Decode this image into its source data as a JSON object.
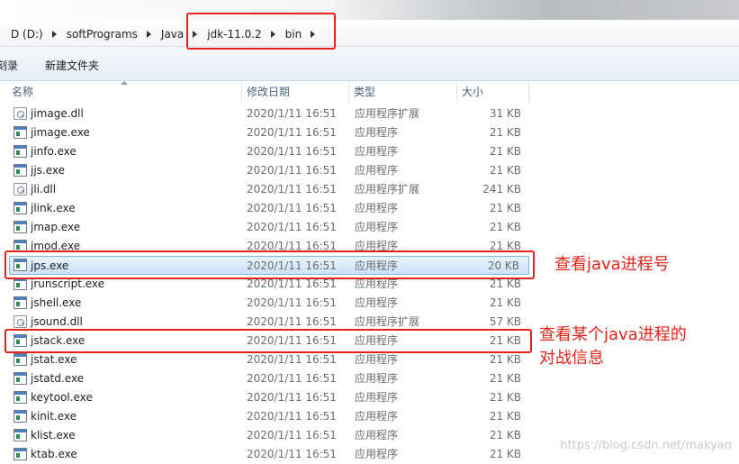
{
  "breadcrumb": [
    "D (D:)",
    "softPrograms",
    "Java",
    "jdk-11.0.2",
    "bin"
  ],
  "toolbar": {
    "item_left": "刻录",
    "new_folder": "新建文件夹"
  },
  "columns": {
    "name": "名称",
    "date": "修改日期",
    "type": "类型",
    "size": "大小"
  },
  "files": [
    {
      "name": "jimage.dll",
      "date": "2020/1/11 16:51",
      "type": "应用程序扩展",
      "size": "31 KB",
      "icon": "dll-icon"
    },
    {
      "name": "jimage.exe",
      "date": "2020/1/11 16:51",
      "type": "应用程序",
      "size": "21 KB",
      "icon": "exe-icon"
    },
    {
      "name": "jinfo.exe",
      "date": "2020/1/11 16:51",
      "type": "应用程序",
      "size": "21 KB",
      "icon": "exe-icon"
    },
    {
      "name": "jjs.exe",
      "date": "2020/1/11 16:51",
      "type": "应用程序",
      "size": "21 KB",
      "icon": "exe-icon"
    },
    {
      "name": "jli.dll",
      "date": "2020/1/11 16:51",
      "type": "应用程序扩展",
      "size": "241 KB",
      "icon": "dll-icon"
    },
    {
      "name": "jlink.exe",
      "date": "2020/1/11 16:51",
      "type": "应用程序",
      "size": "21 KB",
      "icon": "exe-icon"
    },
    {
      "name": "jmap.exe",
      "date": "2020/1/11 16:51",
      "type": "应用程序",
      "size": "21 KB",
      "icon": "exe-icon"
    },
    {
      "name": "jmod.exe",
      "date": "2020/1/11 16:51",
      "type": "应用程序",
      "size": "21 KB",
      "icon": "exe-icon"
    },
    {
      "name": "jps.exe",
      "date": "2020/1/11 16:51",
      "type": "应用程序",
      "size": "20 KB",
      "icon": "exe-icon"
    },
    {
      "name": "jrunscript.exe",
      "date": "2020/1/11 16:51",
      "type": "应用程序",
      "size": "21 KB",
      "icon": "exe-icon"
    },
    {
      "name": "jshell.exe",
      "date": "2020/1/11 16:51",
      "type": "应用程序",
      "size": "21 KB",
      "icon": "exe-icon"
    },
    {
      "name": "jsound.dll",
      "date": "2020/1/11 16:51",
      "type": "应用程序扩展",
      "size": "57 KB",
      "icon": "dll-icon"
    },
    {
      "name": "jstack.exe",
      "date": "2020/1/11 16:51",
      "type": "应用程序",
      "size": "21 KB",
      "icon": "exe-icon"
    },
    {
      "name": "jstat.exe",
      "date": "2020/1/11 16:51",
      "type": "应用程序",
      "size": "21 KB",
      "icon": "exe-icon"
    },
    {
      "name": "jstatd.exe",
      "date": "2020/1/11 16:51",
      "type": "应用程序",
      "size": "21 KB",
      "icon": "exe-icon"
    },
    {
      "name": "keytool.exe",
      "date": "2020/1/11 16:51",
      "type": "应用程序",
      "size": "21 KB",
      "icon": "exe-icon"
    },
    {
      "name": "kinit.exe",
      "date": "2020/1/11 16:51",
      "type": "应用程序",
      "size": "21 KB",
      "icon": "exe-icon"
    },
    {
      "name": "klist.exe",
      "date": "2020/1/11 16:51",
      "type": "应用程序",
      "size": "21 KB",
      "icon": "exe-icon"
    },
    {
      "name": "ktab.exe",
      "date": "2020/1/11 16:51",
      "type": "应用程序",
      "size": "21 KB",
      "icon": "exe-icon"
    }
  ],
  "selected_file": "jps.exe",
  "annotations": {
    "jps_note": "查看java进程号",
    "jstack_note_line1": "查看某个java进程的",
    "jstack_note_line2": "对战信息",
    "color": "#e3231a"
  },
  "watermark": "https://blog.csdn.net/makyan"
}
